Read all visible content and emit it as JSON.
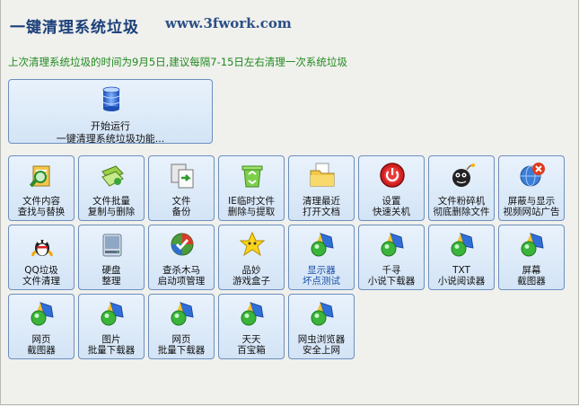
{
  "header": {
    "title": "一键清理系统垃圾",
    "website": "www.3fwork.com"
  },
  "notice": "上次清理系统垃圾的时间为9月5日,建议每隔7-15日左右清理一次系统垃圾",
  "main_button": {
    "line1": "开始运行",
    "line2": "一键清理系统垃圾功能...",
    "icon": "database-icon"
  },
  "tools": [
    {
      "line1": "文件内容",
      "line2": "查找与替换",
      "icon": "file-search-icon"
    },
    {
      "line1": "文件批量",
      "line2": "复制与删除",
      "icon": "file-copy-icon"
    },
    {
      "line1": "文件",
      "line2": "备份",
      "icon": "backup-icon"
    },
    {
      "line1": "IE临时文件",
      "line2": "删除与提取",
      "icon": "recycle-icon"
    },
    {
      "line1": "清理最近",
      "line2": "打开文档",
      "icon": "folder-icon"
    },
    {
      "line1": "设置",
      "line2": "快速关机",
      "icon": "power-icon"
    },
    {
      "line1": "文件粉碎机",
      "line2": "彻底删除文件",
      "icon": "bomb-icon"
    },
    {
      "line1": "屏蔽与显示",
      "line2": "视频网站广告",
      "icon": "block-globe-icon"
    },
    {
      "line1": "QQ垃圾",
      "line2": "文件清理",
      "icon": "qq-icon"
    },
    {
      "line1": "硬盘",
      "line2": "整理",
      "icon": "harddisk-icon"
    },
    {
      "line1": "查杀木马",
      "line2": "启动项管理",
      "icon": "shield-icon"
    },
    {
      "line1": "品妙",
      "line2": "游戏盒子",
      "icon": "star-icon"
    },
    {
      "line1": "显示器",
      "line2": "坏点测试",
      "icon": "gem-icon",
      "highlight": true
    },
    {
      "line1": "千寻",
      "line2": "小说下载器",
      "icon": "gem-icon"
    },
    {
      "line1": "TXT",
      "line2": "小说阅读器",
      "icon": "gem-icon"
    },
    {
      "line1": "屏幕",
      "line2": "截图器",
      "icon": "gem-icon"
    },
    {
      "line1": "网页",
      "line2": "截图器",
      "icon": "gem-icon"
    },
    {
      "line1": "图片",
      "line2": "批量下载器",
      "icon": "gem-icon"
    },
    {
      "line1": "网页",
      "line2": "批量下载器",
      "icon": "gem-icon"
    },
    {
      "line1": "天天",
      "line2": "百宝箱",
      "icon": "gem-icon"
    },
    {
      "line1": "网虫浏览器",
      "line2": "安全上网",
      "icon": "gem-icon"
    }
  ],
  "colors": {
    "title": "#1b3f7a",
    "notice": "#1f8a1f",
    "tile_border": "#6c8fbf",
    "tile_bg": "#d3e4f6",
    "highlight_text": "#1a4fa3"
  }
}
